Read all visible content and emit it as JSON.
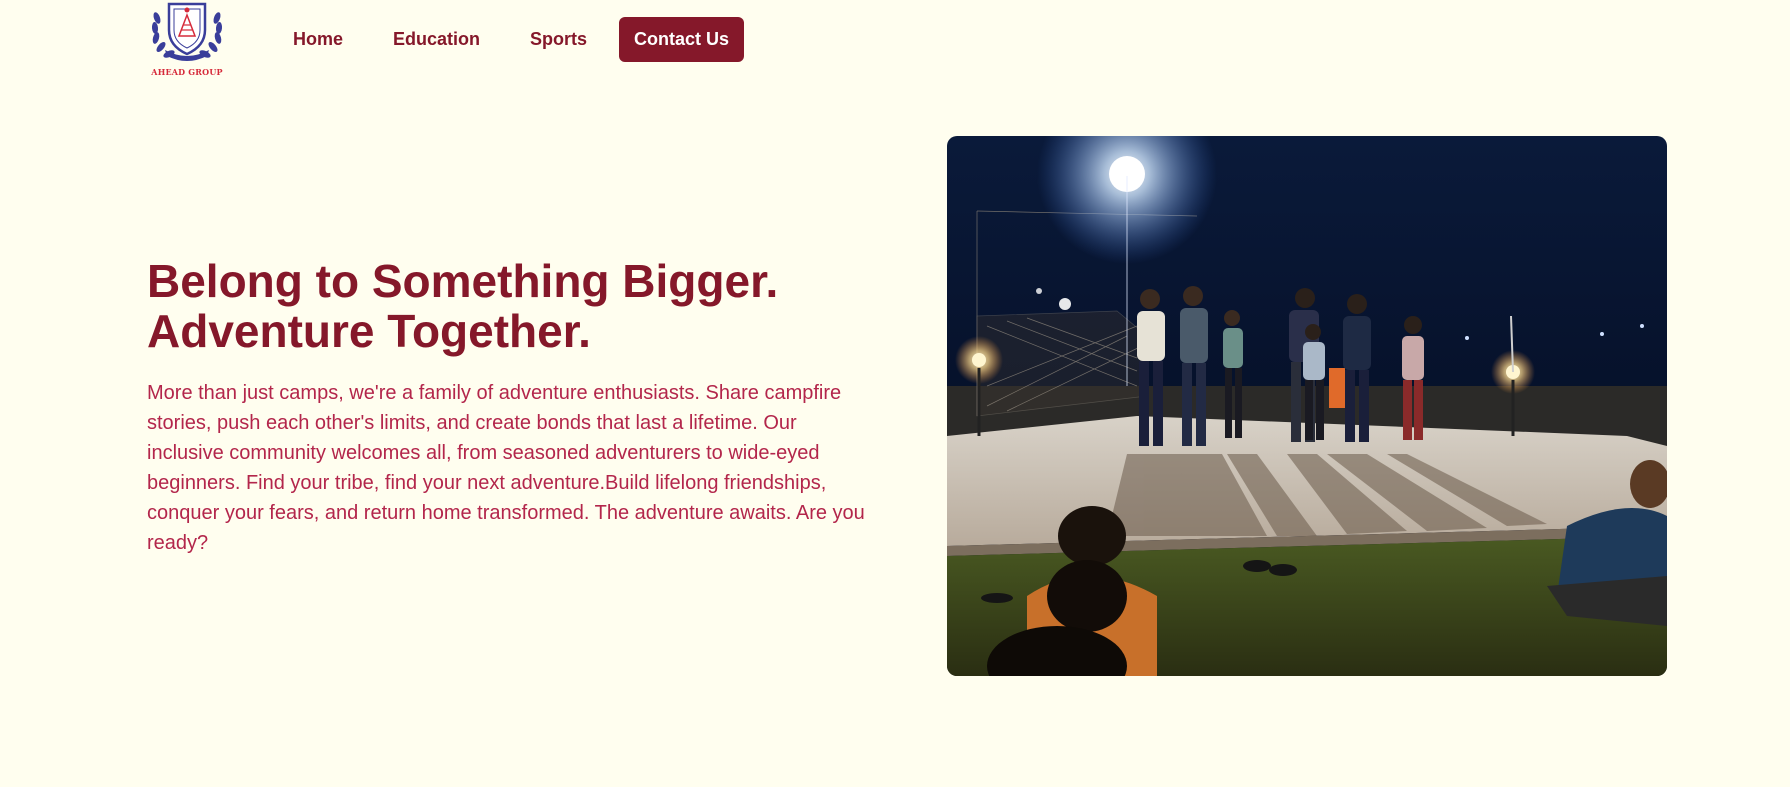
{
  "brand": {
    "logo_text": "AHEAD GROUP",
    "logo_icon": "crest-laurel-icon"
  },
  "nav": {
    "items": [
      {
        "label": "Home"
      },
      {
        "label": "Education"
      },
      {
        "label": "Sports"
      }
    ],
    "cta_label": "Contact Us"
  },
  "hero": {
    "headline_line1": "Belong to Something Bigger.",
    "headline_line2": "Adventure Together.",
    "body": "More than just camps, we're a family of adventure enthusiasts. Share campfire stories, push each other's limits, and create bonds that last a lifetime. Our inclusive community welcomes all, from seasoned adventurers to wide-eyed beginners. Find your tribe, find your next adventure.Build lifelong friendships, conquer your fears, and return home transformed. The adventure awaits. Are you ready?",
    "image_subject": "night-campfire-group-photo"
  },
  "colors": {
    "background": "#fffeef",
    "brand": "#85182a",
    "body_text": "#b3264b",
    "cta_text": "#ffffff"
  }
}
